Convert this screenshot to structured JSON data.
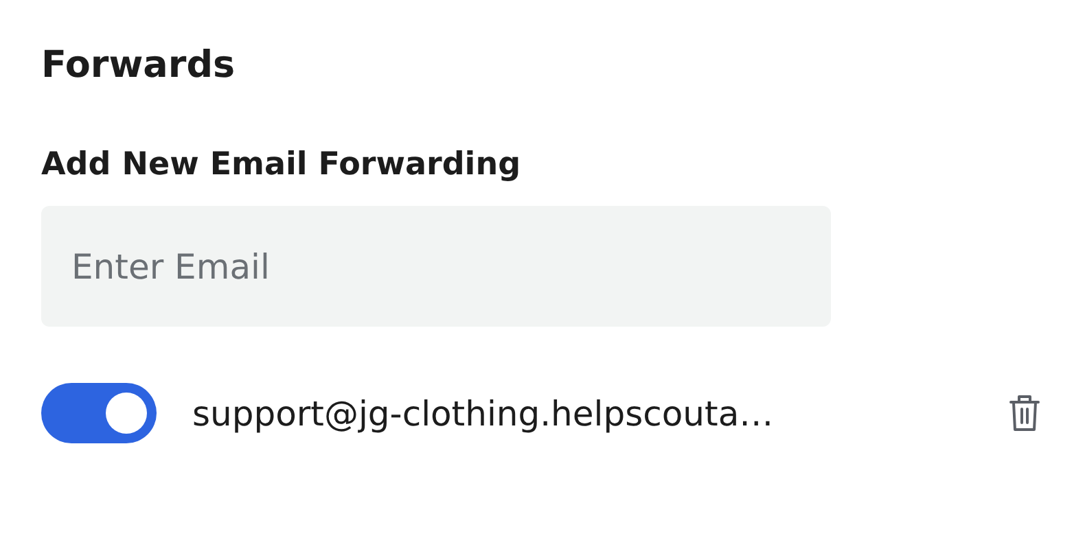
{
  "title": "Forwards",
  "add_forwarding": {
    "label": "Add New Email Forwarding",
    "placeholder": "Enter Email"
  },
  "forwards": [
    {
      "email": "support@jg-clothing.helpscouta…",
      "on": true
    }
  ]
}
